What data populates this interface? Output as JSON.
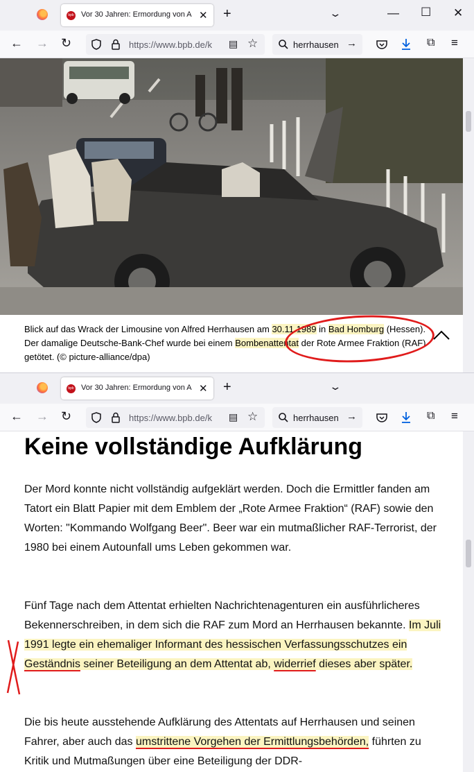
{
  "browser": {
    "tab_title": "Vor 30 Jahren: Ermordung von A",
    "tab_favicon": "bpb",
    "url": "https://www.bpb.de/k",
    "search_text": "herrhausen",
    "icons": [
      "firefox-logo",
      "close-icon",
      "plus-icon",
      "chevron-down-icon",
      "minimize-icon",
      "maximize-icon",
      "window-close-icon",
      "back-icon",
      "forward-icon",
      "reload-icon",
      "shield-icon",
      "lock-icon",
      "reader-view-icon",
      "star-icon",
      "search-icon",
      "arrow-right-icon",
      "pocket-icon",
      "download-icon",
      "extensions-icon",
      "menu-icon"
    ]
  },
  "window1": {
    "photo_description": "Wreck of the bombed limousine with police and onlookers",
    "caption": {
      "part1": "Blick auf das Wrack der Limousine von Alfred Herrhausen am ",
      "date": "30.11.1989",
      "part2": " in ",
      "place": "Bad Homburg",
      "part3": " (Hessen). Der damalige Deutsche-Bank-Chef wurde bei einem ",
      "attack": "Bombenattentat",
      "part4": " der Rote Armee Fraktion (RAF) getötet. (© picture-alliance/dpa)"
    }
  },
  "window2": {
    "heading": "Keine vollständige Aufklärung",
    "p1": "Der Mord konnte nicht vollständig aufgeklärt werden. Doch die Ermittler fanden am Tatort ein Blatt Papier mit dem Emblem der „Rote Armee Fraktion“ (RAF) sowie den Worten: \"Kommando Wolfgang Beer\". Beer war ein mutmaßlicher RAF-Terrorist, der 1980 bei einem Autounfall ums Leben gekommen war.",
    "p2": {
      "a": "Fünf Tage nach dem Attentat erhielten Nachrichtenagenturen ein ausführlicheres Bekennerschreiben, in dem sich die RAF zum Mord an Herrhausen bekannte. ",
      "b": "Im Juli 1991 legte ein ehemaliger Informant des hessischen Verfassungsschutzes ein ",
      "c": "Geständnis",
      "d": " seiner Beteiligung an dem Attentat ab, ",
      "e": "widerrief",
      "f": " dieses aber später."
    },
    "p3": {
      "a": "Die bis heute ausstehende Aufklärung des Attentats auf Herrhausen und seinen Fahrer, aber auch das ",
      "b": "umstrittene Vorgehen der Ermittlungsbehörden,",
      "c": " führten zu Kritik und Mutmaßungen über eine Beteiligung der DDR-"
    }
  },
  "colors": {
    "highlight": "#fbf4c1",
    "annotation_red": "#e01b1b",
    "chrome_bg": "#f0f0f4",
    "accent_blue": "#0060df"
  }
}
